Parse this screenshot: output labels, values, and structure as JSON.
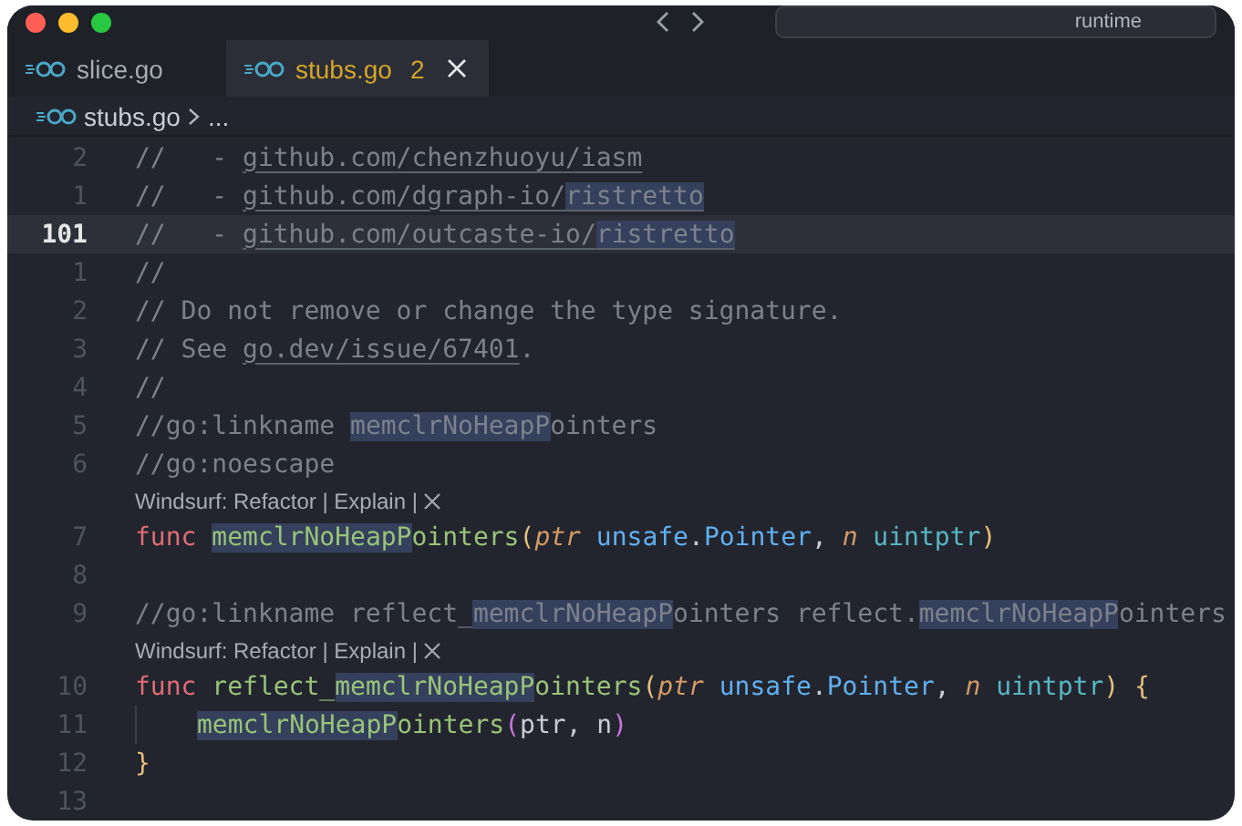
{
  "title_bar": {
    "search": "runtime"
  },
  "tabs": [
    {
      "label": "slice.go",
      "selected": false
    },
    {
      "label": "stubs.go",
      "badge": "2",
      "selected": true
    }
  ],
  "breadcrumb": {
    "file": "stubs.go",
    "rest": "..."
  },
  "lines": [
    {
      "kind": "code",
      "number": "2",
      "current": false,
      "tokens": [
        {
          "kind": "comment",
          "text": "//   - "
        },
        {
          "kind": "link",
          "text": "github.com/chenzhuoyu/iasm"
        }
      ]
    },
    {
      "kind": "code",
      "number": "1",
      "current": false,
      "tokens": [
        {
          "kind": "comment",
          "text": "//   - "
        },
        {
          "kind": "link",
          "text": "github.com/dgraph-io/"
        },
        {
          "kind": "link",
          "text": "ristretto",
          "match": true
        }
      ]
    },
    {
      "kind": "code",
      "number": "101",
      "current": true,
      "tokens": [
        {
          "kind": "comment",
          "text": "//   - "
        },
        {
          "kind": "link",
          "text": "github.com/outcaste-io/"
        },
        {
          "kind": "link",
          "text": "ristretto",
          "match": true
        }
      ]
    },
    {
      "kind": "code",
      "number": "1",
      "current": false,
      "tokens": [
        {
          "kind": "comment",
          "text": "//"
        }
      ]
    },
    {
      "kind": "code",
      "number": "2",
      "current": false,
      "tokens": [
        {
          "kind": "comment",
          "text": "// Do not remove or change the type signature."
        }
      ]
    },
    {
      "kind": "code",
      "number": "3",
      "current": false,
      "tokens": [
        {
          "kind": "comment",
          "text": "// See "
        },
        {
          "kind": "link",
          "text": "go.dev/issue/67401"
        },
        {
          "kind": "comment",
          "text": "."
        }
      ]
    },
    {
      "kind": "code",
      "number": "4",
      "current": false,
      "tokens": [
        {
          "kind": "comment",
          "text": "//"
        }
      ]
    },
    {
      "kind": "code",
      "number": "5",
      "current": false,
      "tokens": [
        {
          "kind": "comment",
          "text": "//go:linkname "
        },
        {
          "kind": "comment",
          "text": "memclrNoHeapP",
          "match": true
        },
        {
          "kind": "comment",
          "text": "ointers"
        }
      ]
    },
    {
      "kind": "code",
      "number": "6",
      "current": false,
      "tokens": [
        {
          "kind": "comment",
          "text": "//go:noescape"
        }
      ]
    },
    {
      "kind": "lens",
      "text": "Windsurf: Refactor | Explain |"
    },
    {
      "kind": "code",
      "number": "7",
      "current": false,
      "tokens": [
        {
          "kind": "keyword",
          "text": "func "
        },
        {
          "kind": "func",
          "text": "memclrNoHeapP",
          "match": true
        },
        {
          "kind": "func",
          "text": "ointers"
        },
        {
          "kind": "paren",
          "text": "("
        },
        {
          "kind": "param",
          "text": "ptr"
        },
        {
          "kind": "package",
          "text": " unsafe"
        },
        {
          "kind": "plain",
          "text": "."
        },
        {
          "kind": "package",
          "text": "Pointer"
        },
        {
          "kind": "plain",
          "text": ", "
        },
        {
          "kind": "param",
          "text": "n"
        },
        {
          "kind": "builtin",
          "text": " uintptr"
        },
        {
          "kind": "paren",
          "text": ")"
        }
      ]
    },
    {
      "kind": "code",
      "number": "8",
      "current": false
    },
    {
      "kind": "code",
      "number": "9",
      "current": false,
      "tokens": [
        {
          "kind": "comment",
          "text": "//go:linkname reflect_"
        },
        {
          "kind": "comment",
          "text": "memclrNoHeapP",
          "match": true
        },
        {
          "kind": "comment",
          "text": "ointers reflect."
        },
        {
          "kind": "comment",
          "text": "memclrNoHeapP",
          "match": true
        },
        {
          "kind": "comment",
          "text": "ointers"
        }
      ]
    },
    {
      "kind": "lens",
      "text": "Windsurf: Refactor | Explain |"
    },
    {
      "kind": "code",
      "number": "10",
      "current": false,
      "tokens": [
        {
          "kind": "keyword",
          "text": "func "
        },
        {
          "kind": "func",
          "text": "reflect_"
        },
        {
          "kind": "func",
          "text": "memclrNoHeapP",
          "match": true
        },
        {
          "kind": "func",
          "text": "ointers"
        },
        {
          "kind": "paren",
          "text": "("
        },
        {
          "kind": "param",
          "text": "ptr"
        },
        {
          "kind": "package",
          "text": " unsafe"
        },
        {
          "kind": "plain",
          "text": "."
        },
        {
          "kind": "package",
          "text": "Pointer"
        },
        {
          "kind": "plain",
          "text": ", "
        },
        {
          "kind": "param",
          "text": "n"
        },
        {
          "kind": "builtin",
          "text": " uintptr"
        },
        {
          "kind": "paren",
          "text": ") {"
        }
      ]
    },
    {
      "kind": "code",
      "number": "11",
      "current": false,
      "indent": true,
      "tokens": [
        {
          "kind": "func",
          "text": "memclrNoHeapP",
          "match": true
        },
        {
          "kind": "func",
          "text": "ointers"
        },
        {
          "kind": "call-paren",
          "text": "("
        },
        {
          "kind": "plain",
          "text": "ptr, n"
        },
        {
          "kind": "call-paren",
          "text": ")"
        }
      ]
    },
    {
      "kind": "code",
      "number": "12",
      "current": false,
      "tokens": [
        {
          "kind": "paren",
          "text": "}"
        }
      ]
    },
    {
      "kind": "code",
      "number": "13",
      "current": false
    }
  ]
}
